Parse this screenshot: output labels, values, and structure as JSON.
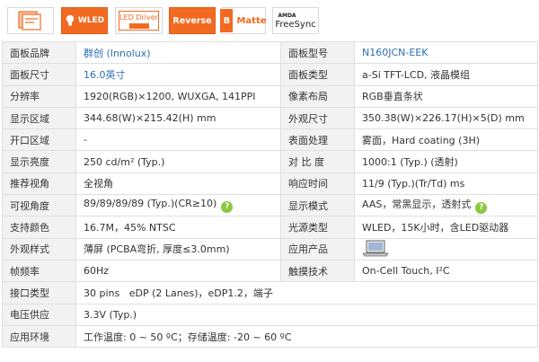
{
  "badges": {
    "wled": "WLED",
    "driver": "LED Driver",
    "reverse": "Reverse",
    "matte_letter": "B",
    "matte": "Matte",
    "freesync_brand": "AMDA",
    "freesync": "FreeSync"
  },
  "colors": {
    "accent": "#f26a21",
    "link": "#2e6fb5",
    "label_bg": "#f2f2f2",
    "help_icon": "#8cc63f"
  },
  "rows": [
    {
      "l1": "面板品牌",
      "v1": "群创 (Innolux)",
      "l2": "面板型号",
      "v2": "N160JCN-EEK"
    },
    {
      "l1": "面板尺寸",
      "v1": "16.0英寸",
      "l2": "面板类型",
      "v2": "a-Si TFT-LCD, 液晶模组"
    },
    {
      "l1": "分辨率",
      "v1": "1920(RGB)×1200, WUXGA, 141PPI",
      "l2": "像素布局",
      "v2": "RGB垂直条状"
    },
    {
      "l1": "显示区域",
      "v1": "344.68(W)×215.42(H) mm",
      "l2": "外观尺寸",
      "v2": "350.38(W)×226.17(H)×5(D) mm"
    },
    {
      "l1": "开口区域",
      "v1": "-",
      "l2": "表面处理",
      "v2": "雾面，Hard coating (3H)"
    },
    {
      "l1": "显示亮度",
      "v1": "250 cd/m² (Typ.)",
      "l2": "对 比 度",
      "v2": "1000:1 (Typ.) (透射)"
    },
    {
      "l1": "推荐视角",
      "v1": "全视角",
      "l2": "响应时间",
      "v2": "11/9 (Typ.)(Tr/Td) ms"
    },
    {
      "l1": "可视角度",
      "v1": "89/89/89/89 (Typ.)(CR≥10)",
      "l2": "显示模式",
      "v2": "AAS，常黑显示，透射式"
    },
    {
      "l1": "支持颜色",
      "v1": "16.7M，45% NTSC",
      "l2": "光源类型",
      "v2": "WLED，15K小时，含LED驱动器"
    },
    {
      "l1": "外观样式",
      "v1": "薄屏 (PCBA弯折, 厚度≤3.0mm)",
      "l2": "应用产品",
      "v2": ""
    },
    {
      "l1": "帧频率",
      "v1": "60Hz",
      "l2": "触摸技术",
      "v2": "On-Cell Touch, I²C"
    },
    {
      "l1": "接口类型",
      "v1": "30 pins   eDP (2 Lanes)，eDP1.2，端子"
    },
    {
      "l1": "电压供应",
      "v1": "3.3V (Typ.)"
    },
    {
      "l1": "应用环境",
      "v1": "工作温度: 0 ~ 50 ºC；存储温度: -20 ~ 60 ºC"
    }
  ]
}
